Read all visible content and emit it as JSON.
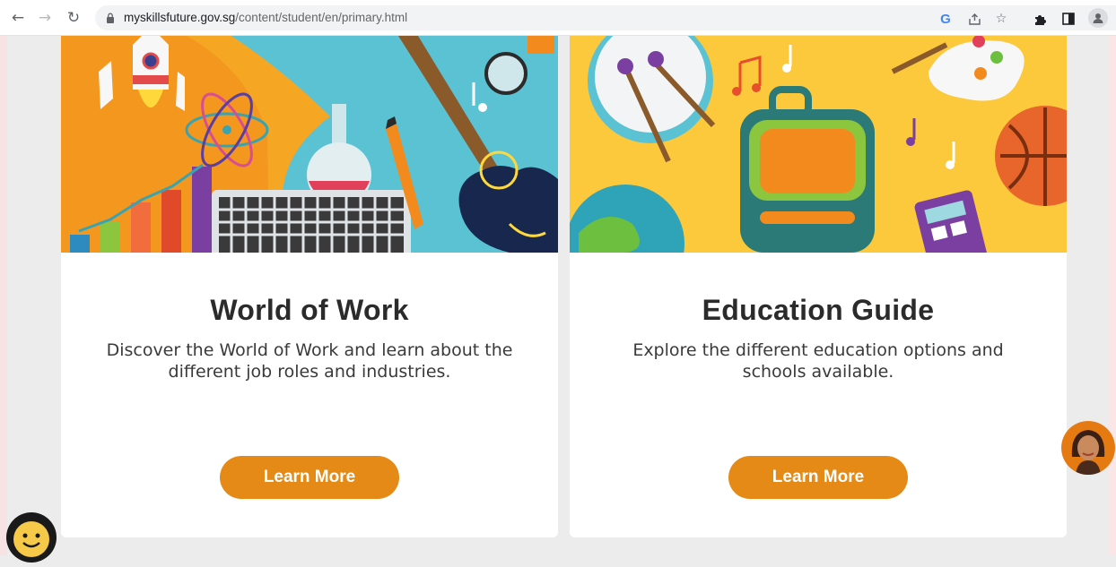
{
  "browser": {
    "url_host": "myskillsfuture.gov.sg",
    "url_path": "/content/student/en/primary.html",
    "google_icon_letter": "G",
    "icons": [
      "back-icon",
      "forward-icon",
      "reload-icon",
      "lock-icon",
      "google-lens-icon",
      "share-icon",
      "bookmark-star-icon",
      "extensions-icon",
      "side-panel-icon",
      "profile-icon"
    ]
  },
  "cards": [
    {
      "title": "World of Work",
      "description": "Discover the World of Work and learn about the different job roles and industries.",
      "button_label": "Learn More"
    },
    {
      "title": "Education Guide",
      "description": "Explore the different education options and schools available.",
      "button_label": "Learn More"
    }
  ],
  "colors": {
    "accent": "#e58a16",
    "left_banner_bg": "#f5a623",
    "left_banner_blue": "#5bc2d4",
    "right_banner_bg": "#fcc83c"
  }
}
